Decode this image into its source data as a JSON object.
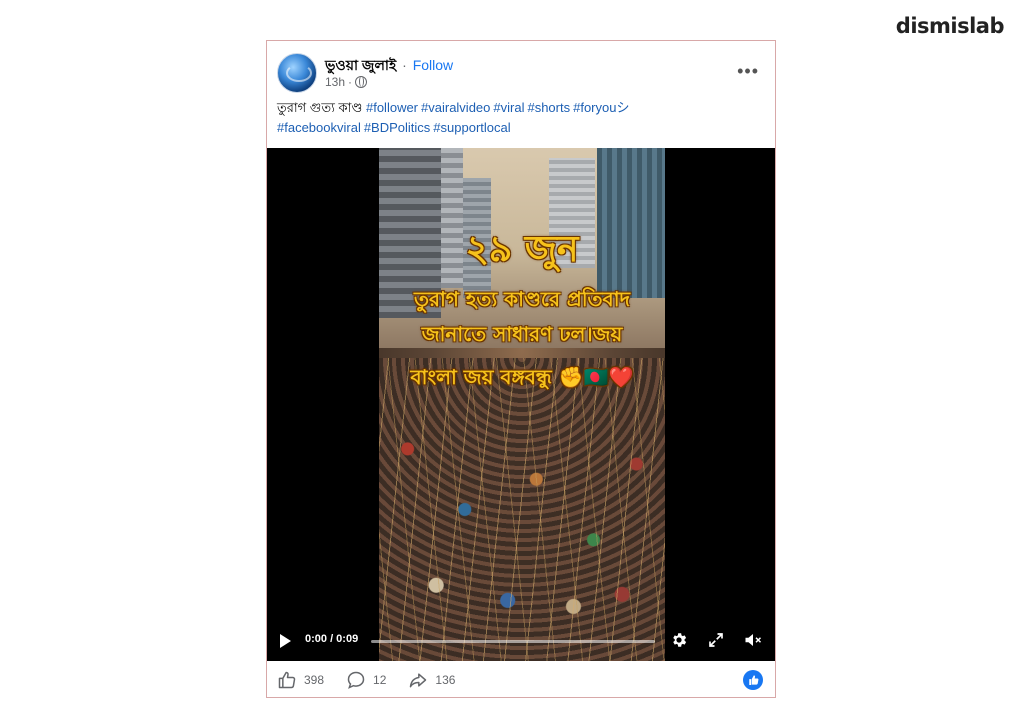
{
  "brand": {
    "logo_text": "dismislab"
  },
  "post": {
    "page_name": "ভুওয়া জুলাই",
    "separator": "·",
    "follow_label": "Follow",
    "timestamp": "13h",
    "meta_separator": "·",
    "privacy_icon": "globe-icon",
    "more_icon": "more-options-icon",
    "caption_text": "তুরাগ গুত্য কাণ্ড",
    "hashtags": [
      "#follower",
      "#vairalvideo",
      "#viral",
      "#shorts",
      "#foryouシ",
      "#facebookviral",
      "#BDPolitics",
      "#supportlocal"
    ]
  },
  "video": {
    "overlay": {
      "date": "২৯ জুন",
      "line1": "তুরাগ হত্য কাণ্ডরে প্রতিবাদ",
      "line2": "জানাতে সাধারণ ঢল।জয়",
      "line3": "বাংলা জয় বঙ্গবন্ধু ✊🇧🇩❤️"
    },
    "time_display": "0:00 / 0:09",
    "progress": 0.0,
    "icons": [
      "play-icon",
      "settings-gear-icon",
      "fullscreen-expand-icon",
      "mute-icon"
    ]
  },
  "footer": {
    "likes": "398",
    "comments": "12",
    "shares": "136",
    "accent_color": "#1877f2"
  }
}
